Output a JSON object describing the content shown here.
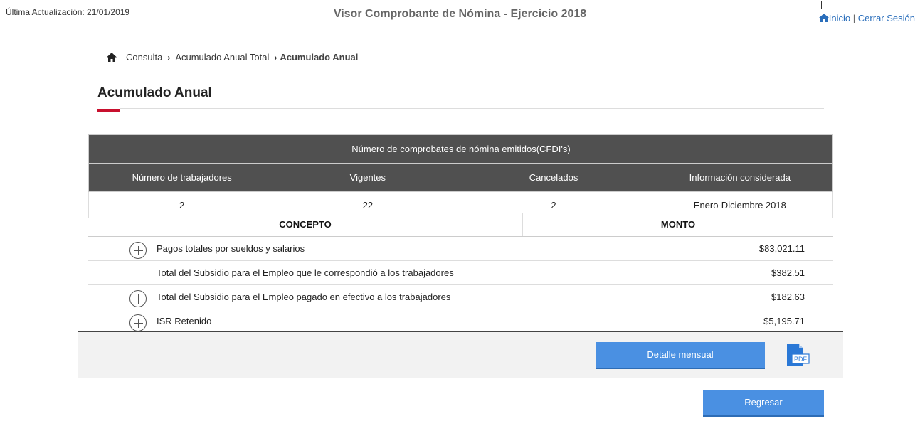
{
  "header": {
    "last_update": "Última Actualización: 21/01/2019",
    "title": "Visor Comprobante de Nómina - Ejercicio 2018",
    "links": {
      "home": "Inicio",
      "separator": "|",
      "logout": "Cerrar Sesión"
    }
  },
  "breadcrumb": {
    "items": [
      "Consulta",
      "Acumulado Anual Total"
    ],
    "current": "Acumulado Anual"
  },
  "page_title": "Acumulado Anual",
  "summary": {
    "group_header": "Número de comprobates de nómina emitidos(CFDI's)",
    "columns": [
      "Número de trabajadores",
      "Vigentes",
      "Cancelados",
      "Información considerada"
    ],
    "row": [
      "2",
      "22",
      "2",
      "Enero-Diciembre 2018"
    ]
  },
  "conceptos": {
    "headers": {
      "concepto": "CONCEPTO",
      "monto": "MONTO"
    },
    "rows": [
      {
        "label": "Pagos totales por sueldos y salarios",
        "amount": "$83,021.11",
        "expandable": true
      },
      {
        "label": "Total del Subsidio para el Empleo que le correspondió a los trabajadores",
        "amount": "$382.51",
        "expandable": false
      },
      {
        "label": "Total del Subsidio para el Empleo pagado en efectivo a los trabajadores",
        "amount": "$182.63",
        "expandable": true
      },
      {
        "label": "ISR Retenido",
        "amount": "$5,195.71",
        "expandable": true
      }
    ]
  },
  "actions": {
    "detalle": "Detalle mensual",
    "pdf_icon": "pdf-file-icon",
    "pdf_label": "PDF",
    "regresar": "Regresar"
  },
  "colors": {
    "accent_red": "#c8102e",
    "button_blue": "#4a90e2",
    "table_header": "#505050",
    "link_blue": "#2a6ebb"
  }
}
